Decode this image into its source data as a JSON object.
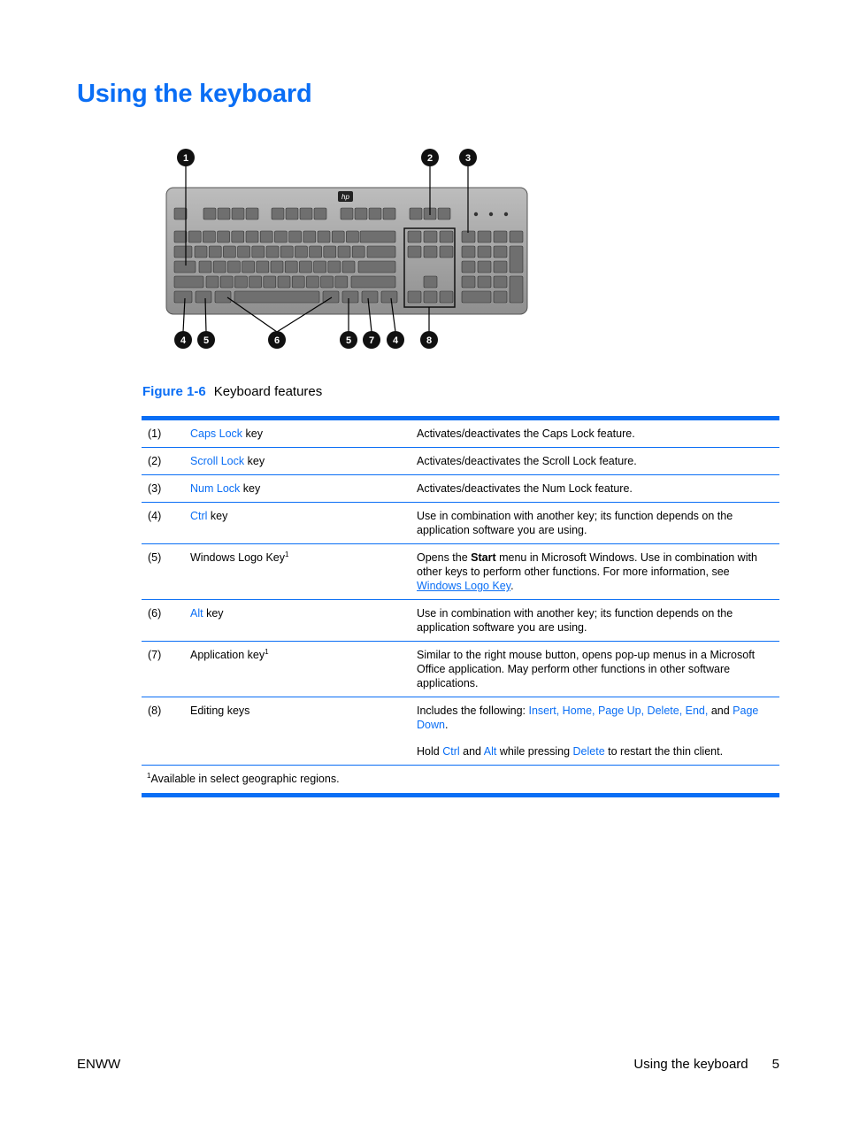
{
  "page": {
    "title": "Using the keyboard",
    "accent_color": "#0a6ef5"
  },
  "figure": {
    "number": "Figure 1-6",
    "caption": "Keyboard features",
    "logo_text": "hp",
    "callouts_top": [
      "1",
      "2",
      "3"
    ],
    "callouts_bottom": [
      "4",
      "5",
      "6",
      "5",
      "7",
      "4",
      "8"
    ]
  },
  "table": {
    "rows": [
      {
        "num": "(1)",
        "link": "Caps Lock",
        "suffix": " key",
        "desc": "Activates/deactivates the Caps Lock feature."
      },
      {
        "num": "(2)",
        "link": "Scroll Lock",
        "suffix": " key",
        "desc": "Activates/deactivates the Scroll Lock feature."
      },
      {
        "num": "(3)",
        "link": "Num Lock",
        "suffix": " key",
        "desc": "Activates/deactivates the Num Lock feature."
      },
      {
        "num": "(4)",
        "link": "Ctrl",
        "suffix": " key",
        "desc": "Use in combination with another key; its function depends on the application software you are using."
      },
      {
        "num": "(5)",
        "feature": "Windows Logo Key",
        "sup": "1",
        "desc_pre": "Opens the ",
        "desc_bold": "Start",
        "desc_mid": " menu in Microsoft Windows. Use in combination with other keys to perform other functions. For more information, see ",
        "desc_link": "Windows Logo Key",
        "desc_post": "."
      },
      {
        "num": "(6)",
        "link": "Alt",
        "suffix": " key",
        "desc": "Use in combination with another key; its function depends on the application software you are using."
      },
      {
        "num": "(7)",
        "feature": "Application key",
        "sup": "1",
        "desc": "Similar to the right mouse button, opens pop-up menus in a Microsoft Office application. May perform other functions in other software applications."
      },
      {
        "num": "(8)",
        "feature": "Editing keys",
        "desc_pre": "Includes the following: ",
        "desc_link1": "Insert, Home, Page Up, Delete, End,",
        "desc_mid": " and ",
        "desc_link2": "Page Down",
        "desc_post": ".",
        "p2_link1": "Ctrl",
        "p2_t1": "Hold ",
        "p2_t2": " and ",
        "p2_link2": "Alt",
        "p2_t3": " while pressing ",
        "p2_link3": "Delete",
        "p2_t4": " to restart the thin client."
      }
    ],
    "footnote_sup": "1",
    "footnote": "Available in select geographic regions."
  },
  "footer": {
    "left": "ENWW",
    "section": "Using the keyboard",
    "page_number": "5"
  }
}
